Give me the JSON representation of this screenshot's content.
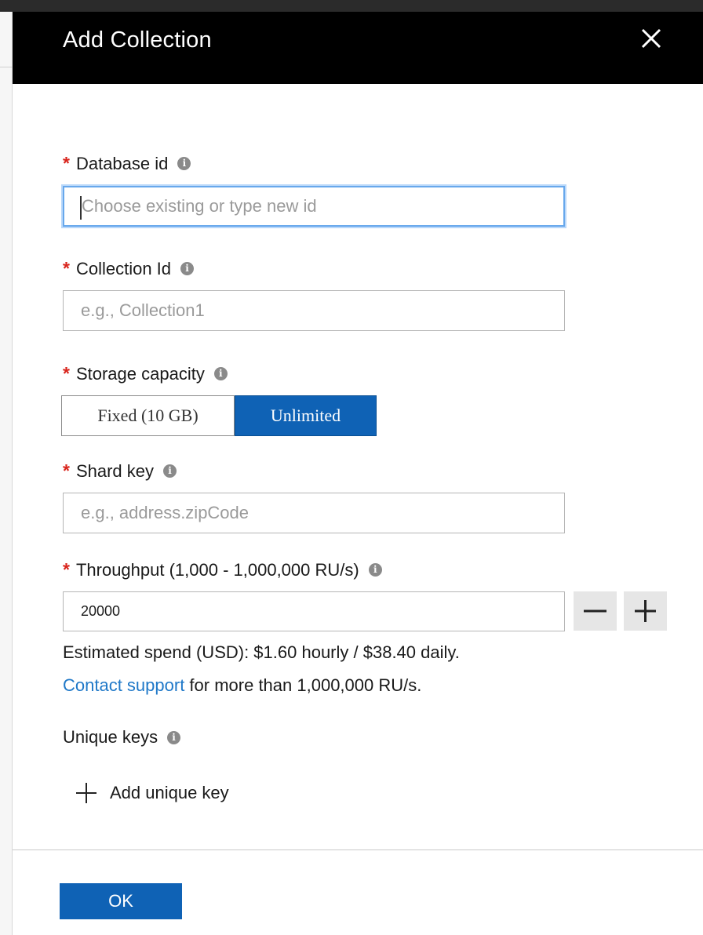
{
  "blade": {
    "title": "Add Collection"
  },
  "fields": {
    "database_id": {
      "label": "Database id",
      "placeholder": "Choose existing or type new id",
      "value": ""
    },
    "collection_id": {
      "label": "Collection Id",
      "placeholder": "e.g., Collection1",
      "value": ""
    },
    "storage_capacity": {
      "label": "Storage capacity",
      "options": [
        "Fixed (10 GB)",
        "Unlimited"
      ],
      "selected": "Unlimited"
    },
    "shard_key": {
      "label": "Shard key",
      "placeholder": "e.g., address.zipCode",
      "value": ""
    },
    "throughput": {
      "label": "Throughput (1,000 - 1,000,000 RU/s)",
      "value": "20000",
      "estimated_spend": "Estimated spend (USD): $1.60 hourly / $38.40 daily.",
      "contact_link": "Contact support",
      "contact_rest": " for more than 1,000,000 RU/s."
    },
    "unique_keys": {
      "label": "Unique keys",
      "add_label": "Add unique key"
    }
  },
  "required_mark": "*",
  "info_glyph": "i",
  "footer": {
    "ok_label": "OK"
  },
  "colors": {
    "header_bg": "#000000",
    "accent": "#0f62b5",
    "required": "#d9251d",
    "link": "#1f78c8",
    "focus": "#68a8ec"
  },
  "icons": {
    "close": "close-icon",
    "info": "info-icon",
    "minus": "minus-icon",
    "plus": "plus-icon",
    "add": "add-icon"
  }
}
